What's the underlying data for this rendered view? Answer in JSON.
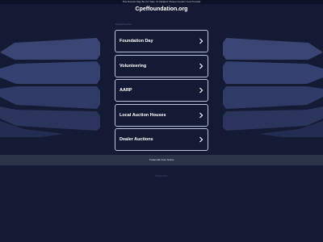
{
  "header": {
    "top_note": "This Domain May Be For Sale. Or Related: Please Contact Your Provider",
    "domain": "Cpeffoundation.org",
    "related_label": "Related Searches"
  },
  "links": [
    {
      "label": "Foundation Day"
    },
    {
      "label": "Volunteering"
    },
    {
      "label": "AARP"
    },
    {
      "label": "Local Auction Houses"
    },
    {
      "label": "Dealer Auctions"
    }
  ],
  "bottom_band": {
    "text": "Trademark Free Notice"
  },
  "footer": {
    "text": "Privacy Policy"
  },
  "icons": {
    "link_arrow": "chevron-right-icon"
  },
  "colors": {
    "background": "#141a33",
    "link_border": "#bcc3df",
    "deco_band": "#3a4573",
    "bottom_band": "#2b3348"
  }
}
